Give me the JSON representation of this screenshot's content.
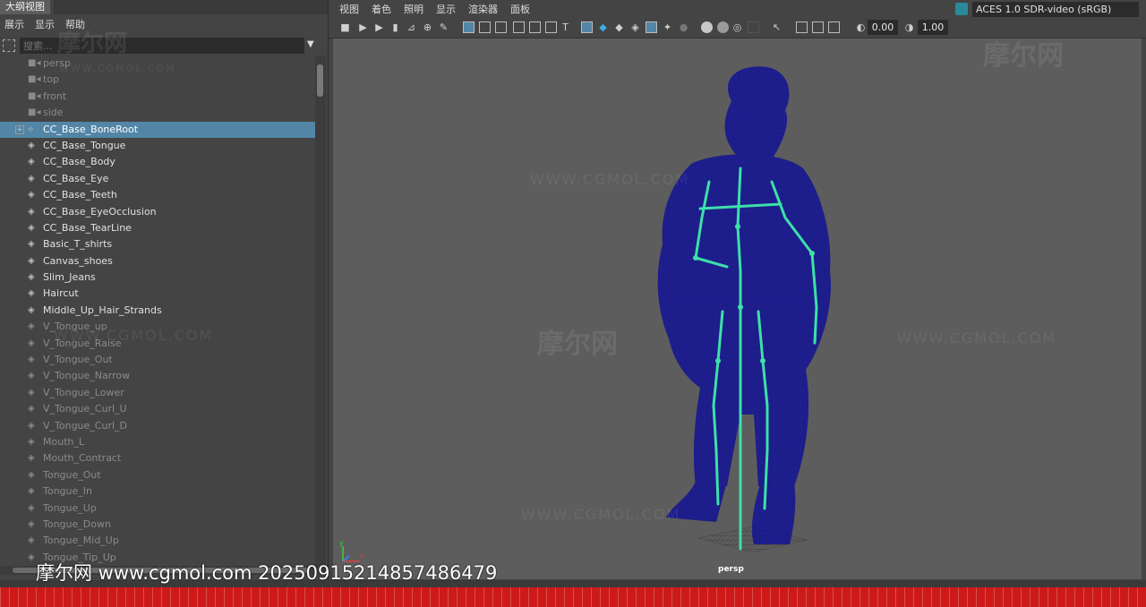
{
  "outliner": {
    "title": "大纲视图",
    "menu": [
      "展示",
      "显示",
      "帮助"
    ],
    "search_placeholder": "搜索...",
    "items": [
      {
        "label": "persp",
        "kind": "camera",
        "dim": true
      },
      {
        "label": "top",
        "kind": "camera",
        "dim": true
      },
      {
        "label": "front",
        "kind": "camera",
        "dim": true
      },
      {
        "label": "side",
        "kind": "camera",
        "dim": true
      },
      {
        "label": "CC_Base_BoneRoot",
        "kind": "joint",
        "selected": true
      },
      {
        "label": "CC_Base_Tongue",
        "kind": "mesh"
      },
      {
        "label": "CC_Base_Body",
        "kind": "mesh"
      },
      {
        "label": "CC_Base_Eye",
        "kind": "mesh"
      },
      {
        "label": "CC_Base_Teeth",
        "kind": "mesh"
      },
      {
        "label": "CC_Base_EyeOcclusion",
        "kind": "mesh"
      },
      {
        "label": "CC_Base_TearLine",
        "kind": "mesh"
      },
      {
        "label": "Basic_T_shirts",
        "kind": "mesh"
      },
      {
        "label": "Canvas_shoes",
        "kind": "mesh"
      },
      {
        "label": "Slim_Jeans",
        "kind": "mesh"
      },
      {
        "label": "Haircut",
        "kind": "mesh"
      },
      {
        "label": "Middle_Up_Hair_Strands",
        "kind": "mesh"
      },
      {
        "label": "V_Tongue_up",
        "kind": "mesh",
        "dim": true
      },
      {
        "label": "V_Tongue_Raise",
        "kind": "mesh",
        "dim": true
      },
      {
        "label": "V_Tongue_Out",
        "kind": "mesh",
        "dim": true
      },
      {
        "label": "V_Tongue_Narrow",
        "kind": "mesh",
        "dim": true
      },
      {
        "label": "V_Tongue_Lower",
        "kind": "mesh",
        "dim": true
      },
      {
        "label": "V_Tongue_Curl_U",
        "kind": "mesh",
        "dim": true
      },
      {
        "label": "V_Tongue_Curl_D",
        "kind": "mesh",
        "dim": true
      },
      {
        "label": "Mouth_L",
        "kind": "mesh",
        "dim": true
      },
      {
        "label": "Mouth_Contract",
        "kind": "mesh",
        "dim": true
      },
      {
        "label": "Tongue_Out",
        "kind": "mesh",
        "dim": true
      },
      {
        "label": "Tongue_In",
        "kind": "mesh",
        "dim": true
      },
      {
        "label": "Tongue_Up",
        "kind": "mesh",
        "dim": true
      },
      {
        "label": "Tongue_Down",
        "kind": "mesh",
        "dim": true
      },
      {
        "label": "Tongue_Mid_Up",
        "kind": "mesh",
        "dim": true
      },
      {
        "label": "Tongue_Tip_Up",
        "kind": "mesh",
        "dim": true
      }
    ]
  },
  "panel": {
    "menu": [
      "视图",
      "着色",
      "照明",
      "显示",
      "渲染器",
      "面板"
    ],
    "exposure": "0.00",
    "gamma": "1.00",
    "color_space": "ACES 1.0 SDR-video (sRGB)",
    "camera_label": "persp",
    "axis_x": "x",
    "axis_y": "y"
  },
  "colors": {
    "wire": "#1a1a8c",
    "skeleton": "#3de0a8",
    "selected": "#5285a6",
    "timeline": "#cc1a1a"
  },
  "watermark": {
    "caption": "摩尔网 www.cgmol.com 20250915214857486479",
    "logo": "摩尔网",
    "url": "WWW.CGMOL.COM"
  }
}
